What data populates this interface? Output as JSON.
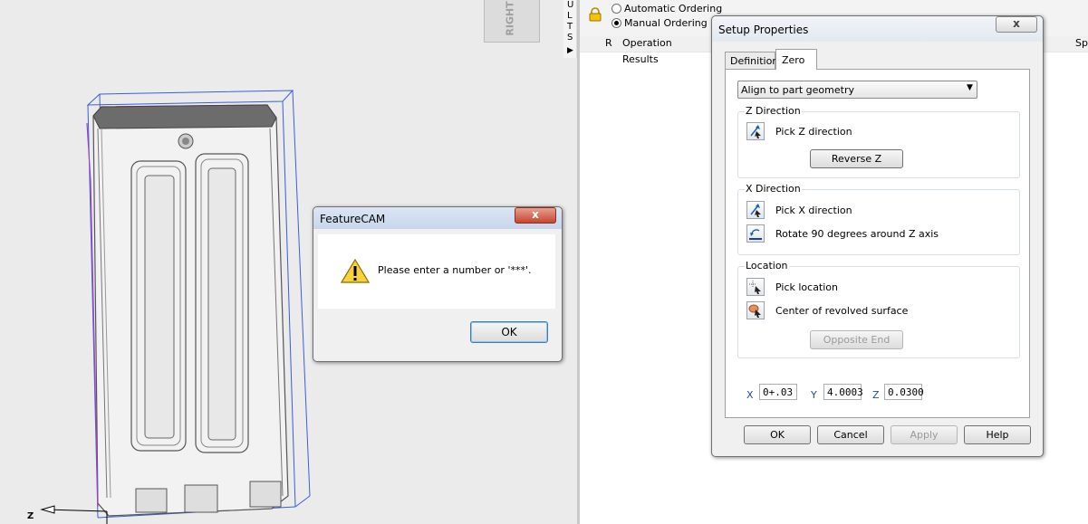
{
  "viewport": {
    "view_label": "RIGHT",
    "axis_label": "Z"
  },
  "results_strip": {
    "letters": [
      "U",
      "L",
      "T",
      "S"
    ],
    "arrow": "▶"
  },
  "ordering": {
    "automatic_label": "Automatic Ordering",
    "manual_label": "Manual Ordering",
    "selected": "manual"
  },
  "grid": {
    "col_r": "R",
    "col_operation": "Operation",
    "col_cut": "Sp",
    "row_results": "Results"
  },
  "alert": {
    "title": "FeatureCAM",
    "message": "Please enter a number or '***'.",
    "ok_label": "OK",
    "close_glyph": "x"
  },
  "setup": {
    "title": "Setup Properties",
    "close_glyph": "x",
    "tabs": [
      "Definition",
      "Zero"
    ],
    "active_tab": "Zero",
    "align_dropdown": "Align to part geometry",
    "z_group": {
      "title": "Z Direction",
      "pick_label": "Pick Z direction",
      "reverse_label": "Reverse Z"
    },
    "x_group": {
      "title": "X Direction",
      "pick_label": "Pick X direction",
      "rotate_label": "Rotate 90 degrees around Z axis"
    },
    "loc_group": {
      "title": "Location",
      "pick_label": "Pick location",
      "center_label": "Center of revolved surface",
      "opposite_label": "Opposite End"
    },
    "coords": {
      "x_label": "X",
      "x_value": "0+.03",
      "y_label": "Y",
      "y_value": "4.0003",
      "z_label": "Z",
      "z_value": "0.0300"
    },
    "buttons": {
      "ok": "OK",
      "cancel": "Cancel",
      "apply": "Apply",
      "help": "Help"
    }
  },
  "colors": {
    "bbox": "#3a5fd8",
    "part_outline": "#a040c8",
    "accent": "#3c7fb1"
  }
}
